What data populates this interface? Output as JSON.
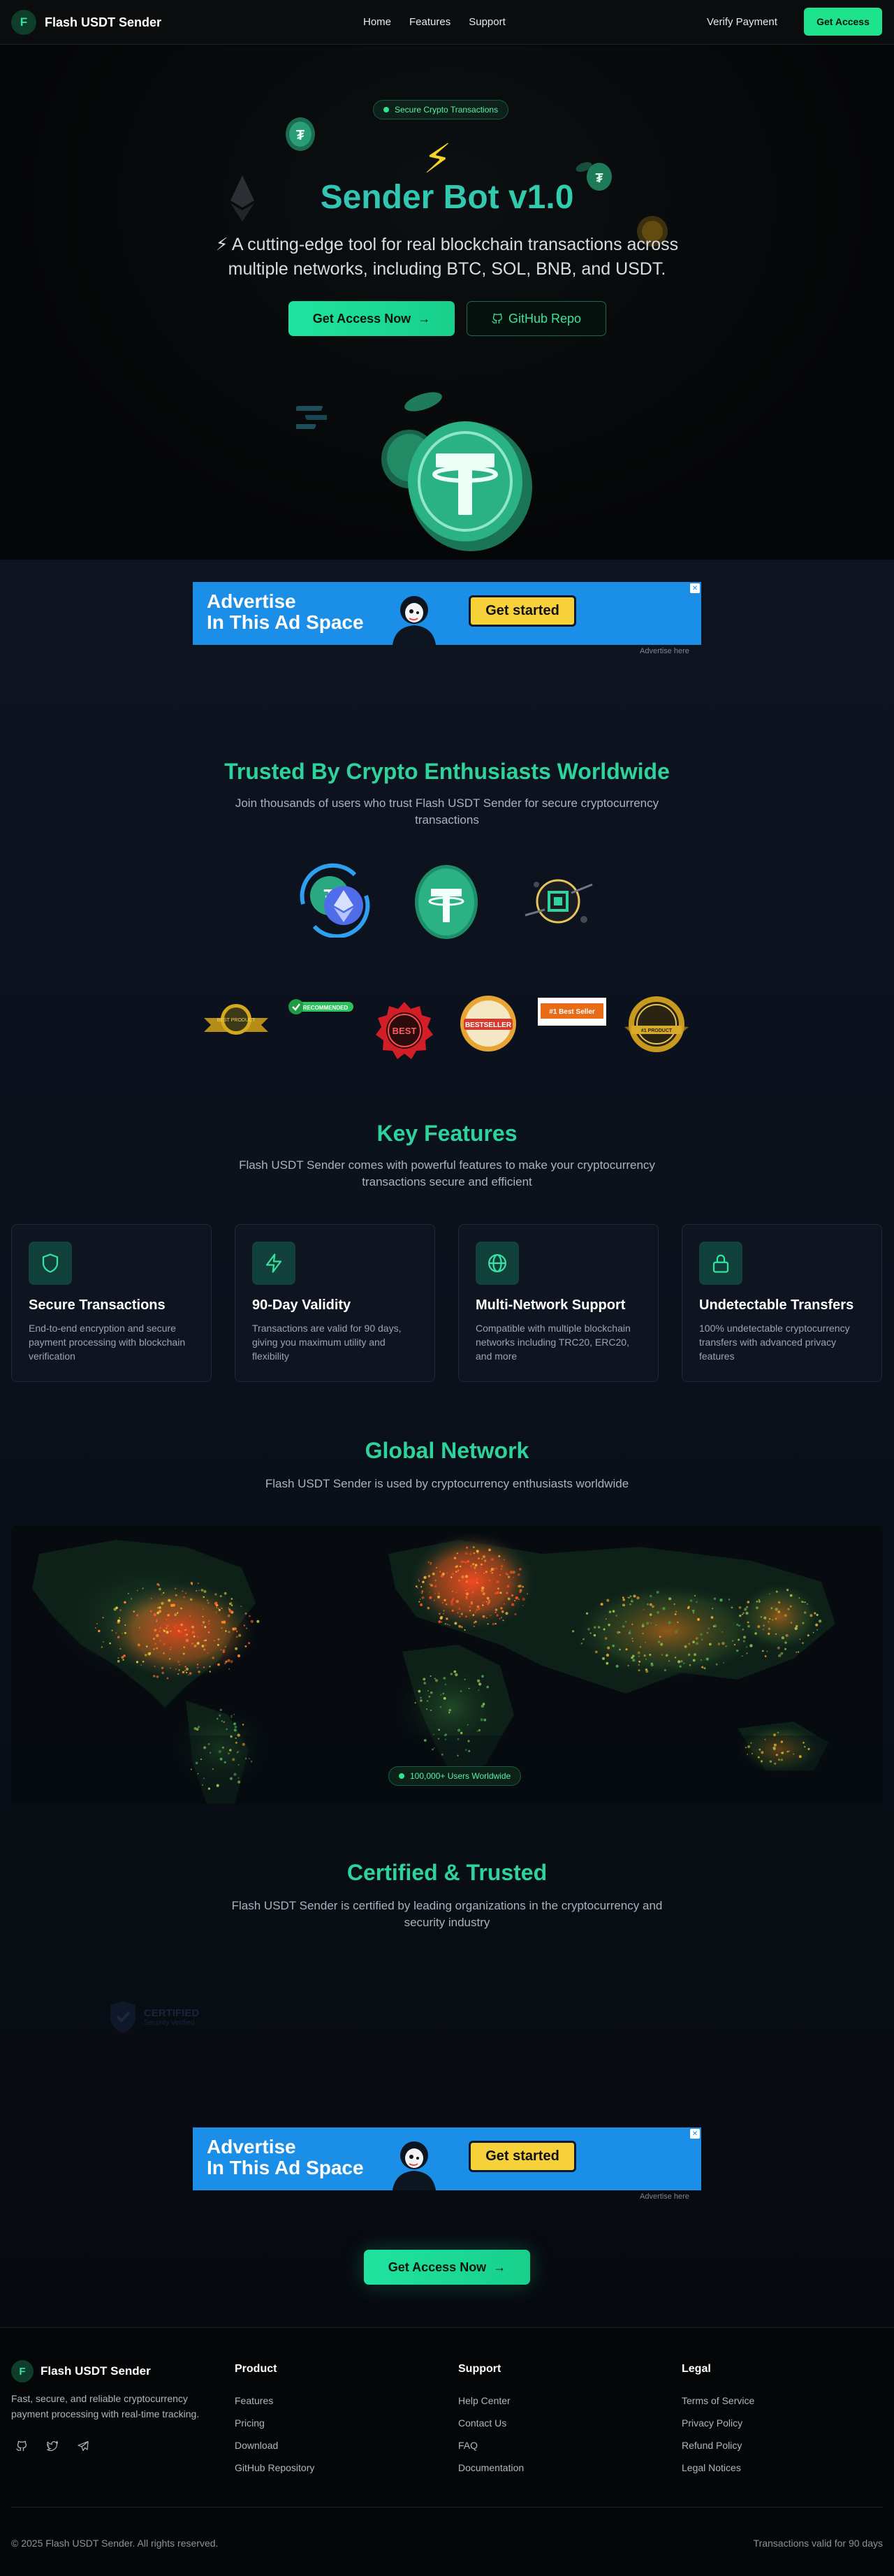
{
  "nav": {
    "logo_letter": "F",
    "brand": "Flash USDT Sender",
    "links": [
      "Home",
      "Features",
      "Support"
    ],
    "verify": "Verify Payment",
    "cta": "Get Access"
  },
  "hero": {
    "pill": "Secure Crypto Transactions",
    "title": "Sender Bot v1.0",
    "subtitle": "⚡ A cutting-edge tool for real blockchain transactions across multiple networks, including BTC, SOL, BNB, and USDT.",
    "primary_cta": "Get Access Now",
    "secondary_cta": "GitHub Repo"
  },
  "ad": {
    "line1": "Advertise",
    "line2": "In This Ad Space",
    "button": "Get started",
    "label": "Advertise here"
  },
  "trusted": {
    "title": "Trusted By Crypto Enthusiasts Worldwide",
    "subtitle": "Join thousands of users who trust Flash USDT Sender for secure cryptocurrency transactions",
    "badges": [
      "BEST PRODUCT",
      "RECOMMENDED",
      "BEST",
      "BESTSELLER",
      "#1 Best Seller",
      "#1 PRODUCT"
    ]
  },
  "features": {
    "title": "Key Features",
    "subtitle": "Flash USDT Sender comes with powerful features to make your cryptocurrency transactions secure and efficient",
    "cards": [
      {
        "icon": "shield-icon",
        "title": "Secure Transactions",
        "desc": "End-to-end encryption and secure payment processing with blockchain verification"
      },
      {
        "icon": "zap-icon",
        "title": "90-Day Validity",
        "desc": "Transactions are valid for 90 days, giving you maximum utility and flexibility"
      },
      {
        "icon": "globe-icon",
        "title": "Multi-Network Support",
        "desc": "Compatible with multiple blockchain networks including TRC20, ERC20, and more"
      },
      {
        "icon": "lock-icon",
        "title": "Undetectable Transfers",
        "desc": "100% undetectable cryptocurrency transfers with advanced privacy features"
      }
    ]
  },
  "network": {
    "title": "Global Network",
    "subtitle": "Flash USDT Sender is used by cryptocurrency enthusiasts worldwide",
    "badge": "100,000+ Users Worldwide"
  },
  "certified": {
    "title": "Certified & Trusted",
    "subtitle": "Flash USDT Sender is certified by leading organizations in the cryptocurrency and security industry",
    "logo_text": "CERTIFIED",
    "logo_sub": "Security Verified"
  },
  "final_cta": "Get Access Now",
  "footer": {
    "brand": "Flash USDT Sender",
    "description": "Fast, secure, and reliable cryptocurrency payment processing with real-time tracking.",
    "product_title": "Product",
    "product_links": [
      "Features",
      "Pricing",
      "Download",
      "GitHub Repository"
    ],
    "support_title": "Support",
    "support_links": [
      "Help Center",
      "Contact Us",
      "FAQ",
      "Documentation"
    ],
    "legal_title": "Legal",
    "legal_links": [
      "Terms of Service",
      "Privacy Policy",
      "Refund Policy",
      "Legal Notices"
    ],
    "copyright": "© 2025 Flash USDT Sender. All rights reserved.",
    "validity": "Transactions valid for 90 days"
  },
  "colors": {
    "accent": "#1de38c",
    "title_teal": "#2dd39b",
    "ad_blue": "#1b8fe8",
    "ad_yellow": "#f7d13a",
    "tether_green": "#26a17b"
  }
}
